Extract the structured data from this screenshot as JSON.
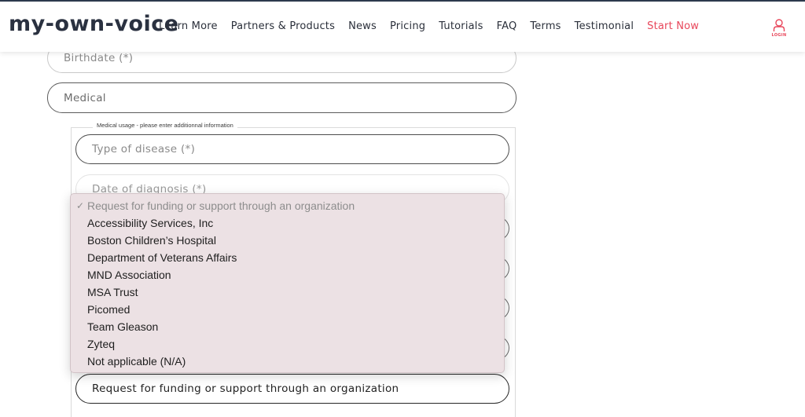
{
  "header": {
    "logo": "my-own-voice",
    "nav": [
      {
        "label": "Learn More"
      },
      {
        "label": "Partners & Products"
      },
      {
        "label": "News"
      },
      {
        "label": "Pricing"
      },
      {
        "label": "Tutorials"
      },
      {
        "label": "FAQ"
      },
      {
        "label": "Terms"
      },
      {
        "label": "Testimonial"
      },
      {
        "label": "Start Now"
      }
    ],
    "login_label": "LOGIN",
    "accent_color": "#e8465a"
  },
  "form": {
    "birthdate_placeholder": "Birthdate (*)",
    "medical_value": "Medical",
    "medical_section_legend": "Medical usage - please enter additionnal information",
    "disease_placeholder": "Type of disease (*)",
    "diagnosis_placeholder": "Date of diagnosis (*)",
    "request_selected": "Request for funding or support through an organization"
  },
  "dropdown": {
    "selected_option": "Request for funding or support through an organization",
    "check_mark": "✓",
    "options": [
      "Accessibility Services, Inc",
      "Boston Children’s Hospital",
      "Department of Veterans Affairs",
      "MND Association",
      "MSA Trust",
      "Picomed",
      "Team Gleason",
      "Zyteq",
      "Not applicable (N/A)"
    ]
  }
}
